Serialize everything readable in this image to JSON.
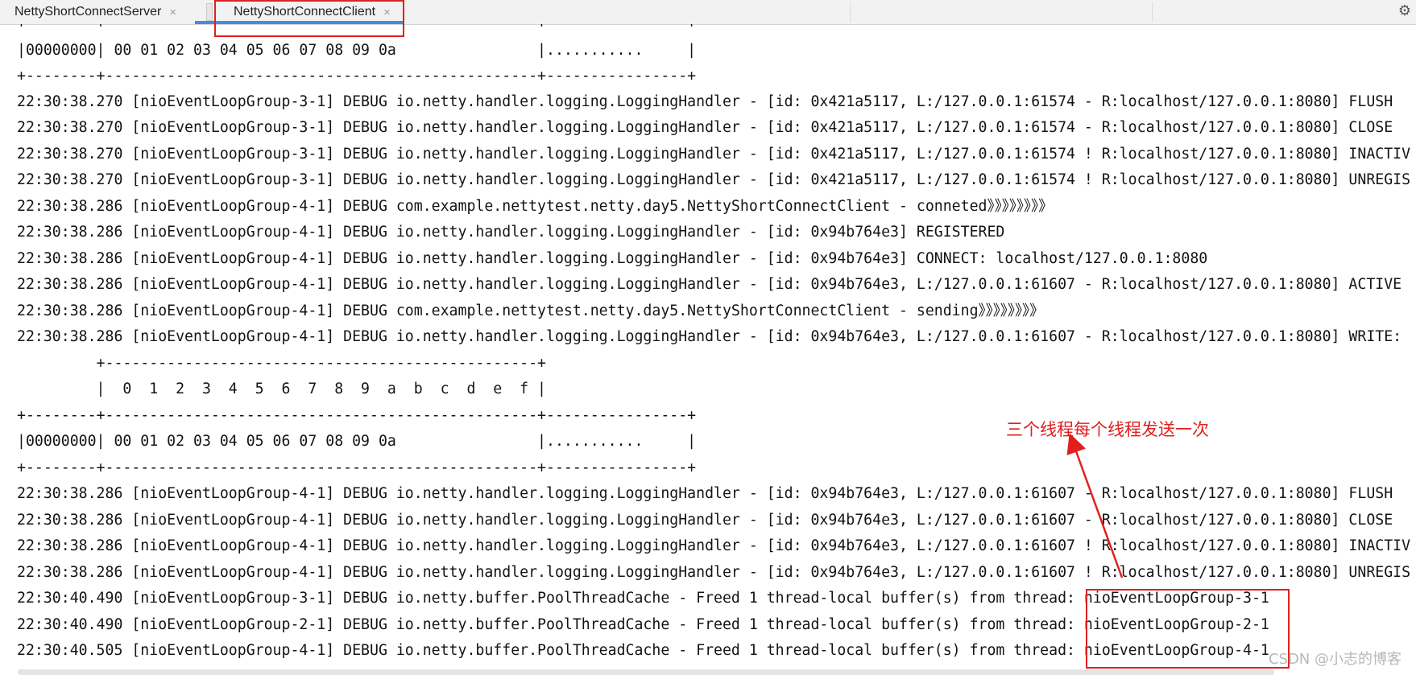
{
  "tabs": [
    {
      "label": "NettyShortConnectServer",
      "close": "×",
      "active": false
    },
    {
      "label": "NettyShortConnectClient",
      "close": "×",
      "active": true
    }
  ],
  "toolbar": {
    "gear_icon": "gear-icon"
  },
  "console_lines": [
    "+--------+-------------------------------------------------+----------------+",
    "|00000000| 00 01 02 03 04 05 06 07 08 09 0a                |...........     |",
    "+--------+-------------------------------------------------+----------------+",
    "22:30:38.270 [nioEventLoopGroup-3-1] DEBUG io.netty.handler.logging.LoggingHandler - [id: 0x421a5117, L:/127.0.0.1:61574 - R:localhost/127.0.0.1:8080] FLUSH",
    "22:30:38.270 [nioEventLoopGroup-3-1] DEBUG io.netty.handler.logging.LoggingHandler - [id: 0x421a5117, L:/127.0.0.1:61574 - R:localhost/127.0.0.1:8080] CLOSE",
    "22:30:38.270 [nioEventLoopGroup-3-1] DEBUG io.netty.handler.logging.LoggingHandler - [id: 0x421a5117, L:/127.0.0.1:61574 ! R:localhost/127.0.0.1:8080] INACTIV",
    "22:30:38.270 [nioEventLoopGroup-3-1] DEBUG io.netty.handler.logging.LoggingHandler - [id: 0x421a5117, L:/127.0.0.1:61574 ! R:localhost/127.0.0.1:8080] UNREGIS",
    "22:30:38.286 [nioEventLoopGroup-4-1] DEBUG com.example.nettytest.netty.day5.NettyShortConnectClient - conneted》》》》》》》》",
    "22:30:38.286 [nioEventLoopGroup-4-1] DEBUG io.netty.handler.logging.LoggingHandler - [id: 0x94b764e3] REGISTERED",
    "22:30:38.286 [nioEventLoopGroup-4-1] DEBUG io.netty.handler.logging.LoggingHandler - [id: 0x94b764e3] CONNECT: localhost/127.0.0.1:8080",
    "22:30:38.286 [nioEventLoopGroup-4-1] DEBUG io.netty.handler.logging.LoggingHandler - [id: 0x94b764e3, L:/127.0.0.1:61607 - R:localhost/127.0.0.1:8080] ACTIVE",
    "22:30:38.286 [nioEventLoopGroup-4-1] DEBUG com.example.nettytest.netty.day5.NettyShortConnectClient - sending》》》》》》》》",
    "22:30:38.286 [nioEventLoopGroup-4-1] DEBUG io.netty.handler.logging.LoggingHandler - [id: 0x94b764e3, L:/127.0.0.1:61607 - R:localhost/127.0.0.1:8080] WRITE:",
    "         +-------------------------------------------------+",
    "         |  0  1  2  3  4  5  6  7  8  9  a  b  c  d  e  f |",
    "+--------+-------------------------------------------------+----------------+",
    "|00000000| 00 01 02 03 04 05 06 07 08 09 0a                |...........     |",
    "+--------+-------------------------------------------------+----------------+",
    "22:30:38.286 [nioEventLoopGroup-4-1] DEBUG io.netty.handler.logging.LoggingHandler - [id: 0x94b764e3, L:/127.0.0.1:61607 - R:localhost/127.0.0.1:8080] FLUSH",
    "22:30:38.286 [nioEventLoopGroup-4-1] DEBUG io.netty.handler.logging.LoggingHandler - [id: 0x94b764e3, L:/127.0.0.1:61607 - R:localhost/127.0.0.1:8080] CLOSE",
    "22:30:38.286 [nioEventLoopGroup-4-1] DEBUG io.netty.handler.logging.LoggingHandler - [id: 0x94b764e3, L:/127.0.0.1:61607 ! R:localhost/127.0.0.1:8080] INACTIV",
    "22:30:38.286 [nioEventLoopGroup-4-1] DEBUG io.netty.handler.logging.LoggingHandler - [id: 0x94b764e3, L:/127.0.0.1:61607 ! R:localhost/127.0.0.1:8080] UNREGIS",
    "22:30:40.490 [nioEventLoopGroup-3-1] DEBUG io.netty.buffer.PoolThreadCache - Freed 1 thread-local buffer(s) from thread: nioEventLoopGroup-3-1",
    "22:30:40.490 [nioEventLoopGroup-2-1] DEBUG io.netty.buffer.PoolThreadCache - Freed 1 thread-local buffer(s) from thread: nioEventLoopGroup-2-1",
    "22:30:40.505 [nioEventLoopGroup-4-1] DEBUG io.netty.buffer.PoolThreadCache - Freed 1 thread-local buffer(s) from thread: nioEventLoopGroup-4-1"
  ],
  "annotation": {
    "label": "三个线程每个线程发送一次",
    "color": "#e02020"
  },
  "watermark": "CSDN @小志的博客"
}
